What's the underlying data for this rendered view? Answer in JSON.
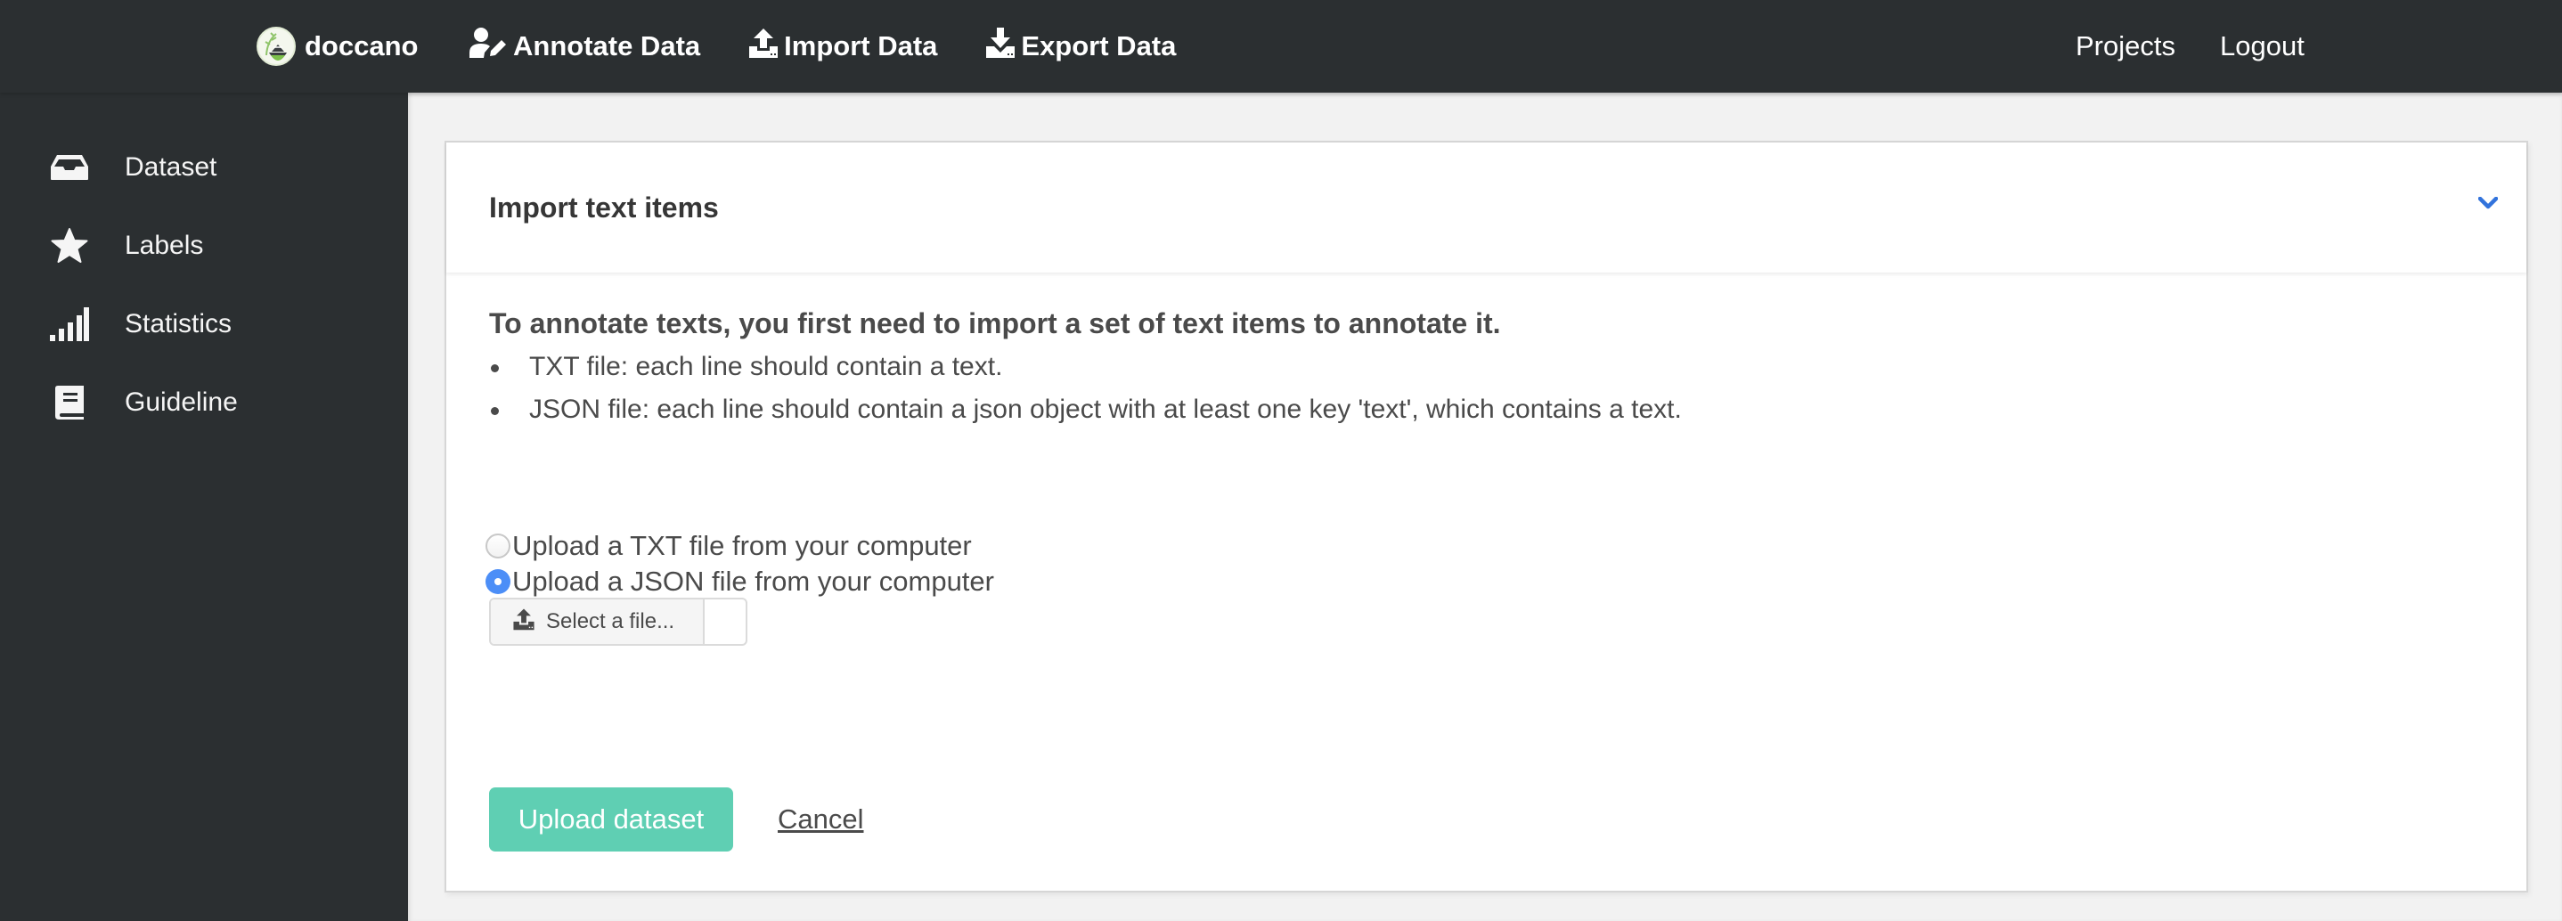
{
  "navbar": {
    "brand": "doccano",
    "left_items": [
      {
        "label": "Annotate Data",
        "icon": "user-edit-icon"
      },
      {
        "label": "Import Data",
        "icon": "upload-icon"
      },
      {
        "label": "Export Data",
        "icon": "download-icon"
      }
    ],
    "right_items": [
      {
        "label": "Projects"
      },
      {
        "label": "Logout"
      }
    ]
  },
  "sidebar": {
    "items": [
      {
        "label": "Dataset",
        "icon": "inbox-icon"
      },
      {
        "label": "Labels",
        "icon": "star-icon"
      },
      {
        "label": "Statistics",
        "icon": "signal-bars-icon"
      },
      {
        "label": "Guideline",
        "icon": "book-icon"
      }
    ]
  },
  "card": {
    "title": "Import text items",
    "collapse_icon": "chevron-down-icon",
    "intro": "To annotate texts, you first need to import a set of text items to annotate it.",
    "bullets": [
      "TXT file: each line should contain a text.",
      "JSON file: each line should contain a json object with at least one key 'text', which contains a text."
    ],
    "format_options": [
      {
        "label": "Upload a TXT file from your computer",
        "checked": false
      },
      {
        "label": "Upload a JSON file from your computer",
        "checked": true
      }
    ],
    "file_input": {
      "button_label": "Select a file...",
      "file_name": ""
    },
    "upload_button": "Upload dataset",
    "cancel_link": "Cancel"
  },
  "colors": {
    "navbar_bg": "#2b2f31",
    "accent_primary": "#5fcfb3",
    "chevron": "#3273dc",
    "radio_checked": "#4c8ef7"
  }
}
